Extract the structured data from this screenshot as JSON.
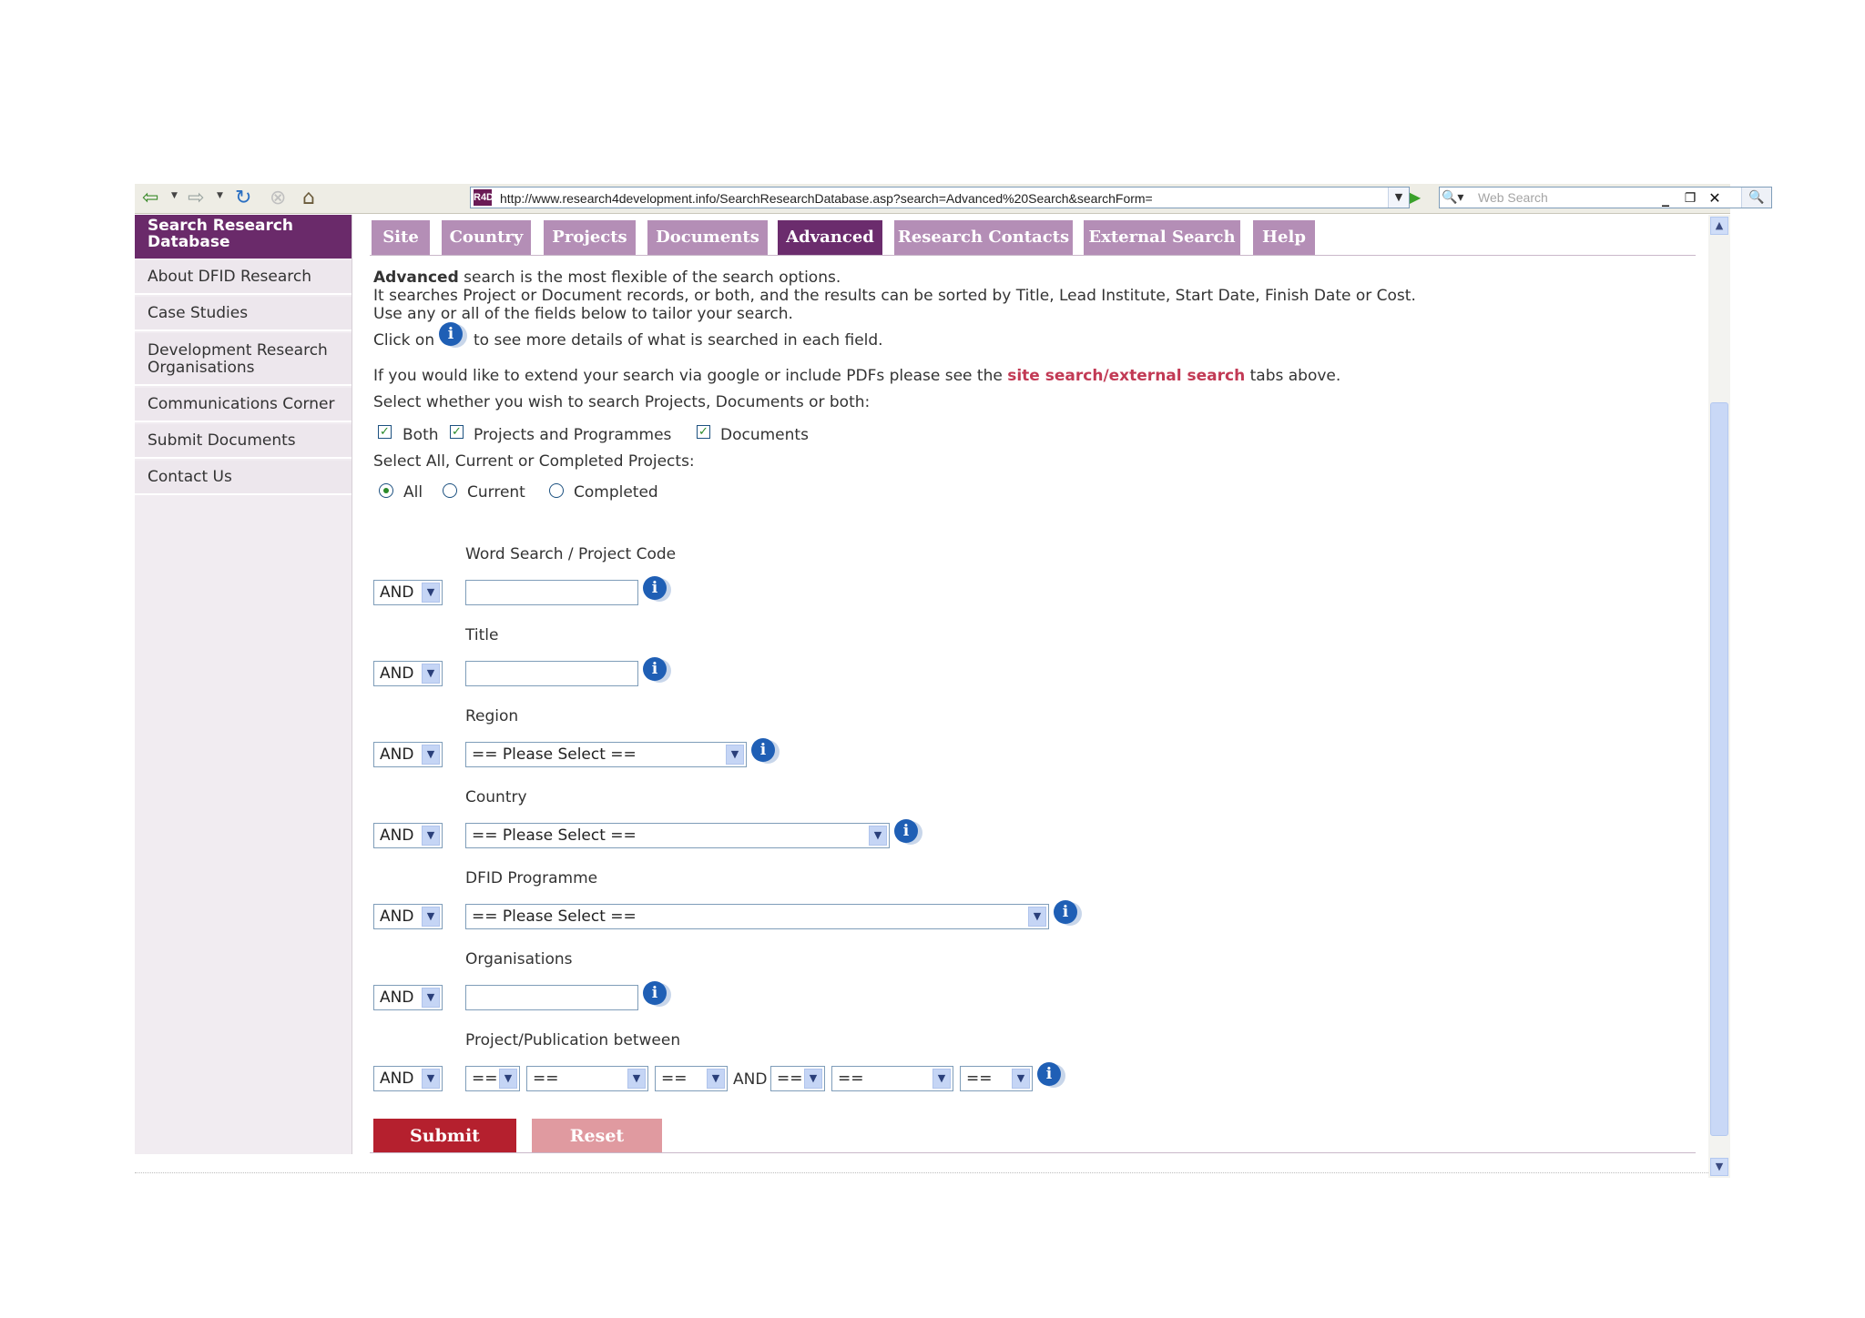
{
  "browser": {
    "url": "http://www.research4development.info/SearchResearchDatabase.asp?search=Advanced%20Search&searchForm=",
    "site_icon": "R4D",
    "web_search_placeholder": "Web Search",
    "back_icon": "back-arrow-icon",
    "forward_icon": "forward-arrow-icon",
    "refresh_icon": "refresh-icon",
    "stop_icon": "stop-icon",
    "home_icon": "home-icon"
  },
  "sidebar": {
    "title": "Search Research Database",
    "items": [
      {
        "label": "About DFID Research"
      },
      {
        "label": "Case Studies"
      },
      {
        "label": "Development Research Organisations"
      },
      {
        "label": "Communications Corner"
      },
      {
        "label": "Submit Documents"
      },
      {
        "label": "Contact Us"
      }
    ]
  },
  "tabs": [
    {
      "label": "Site"
    },
    {
      "label": "Country"
    },
    {
      "label": "Projects"
    },
    {
      "label": "Documents"
    },
    {
      "label": "Advanced",
      "active": true
    },
    {
      "label": "Research Contacts"
    },
    {
      "label": "External Search"
    },
    {
      "label": "Help"
    }
  ],
  "intro": {
    "bold": "Advanced",
    "line1_rest": " search is the most flexible of the search options.",
    "line2": "It searches Project or Document records, or both, and the results can be sorted by Title, Lead Institute, Start Date, Finish Date or Cost.",
    "line3": "Use any or all of the fields below to tailor your search.",
    "click_on": "Click on",
    "click_rest": "to see more details of what is searched in each field.",
    "extend_pre": "If you would like to extend your search via google or include PDFs please see the ",
    "link_site": "site search",
    "slash": "/",
    "link_external": "external search",
    "extend_post": " tabs above.",
    "select_type": "Select whether you wish to search Projects, Documents or both:",
    "select_status": "Select All, Current or Completed Projects:"
  },
  "record_types": [
    {
      "label": "Both",
      "checked": true
    },
    {
      "label": "Projects and Programmes",
      "checked": true
    },
    {
      "label": "Documents",
      "checked": true
    }
  ],
  "project_status": [
    {
      "label": "All",
      "selected": true
    },
    {
      "label": "Current",
      "selected": false
    },
    {
      "label": "Completed",
      "selected": false
    }
  ],
  "fields": {
    "operator": "AND",
    "word_search_label": "Word Search / Project Code",
    "title_label": "Title",
    "region_label": "Region",
    "region_value": "== Please Select ==",
    "country_label": "Country",
    "country_value": "== Please Select ==",
    "programme_label": "DFID Programme",
    "programme_value": "== Please Select ==",
    "organisations_label": "Organisations",
    "between_label": "Project/Publication between",
    "between_and": "AND",
    "date_placeholder": "==",
    "info_glyph": "i"
  },
  "buttons": {
    "submit": "Submit",
    "reset": "Reset"
  },
  "colors": {
    "brand_purple": "#6b2c6d",
    "tab_inactive": "#b48eb6",
    "submit": "#b5202e",
    "reset": "#e09aa0",
    "link": "#c23a55",
    "info_icon": "#1f5fb5"
  }
}
